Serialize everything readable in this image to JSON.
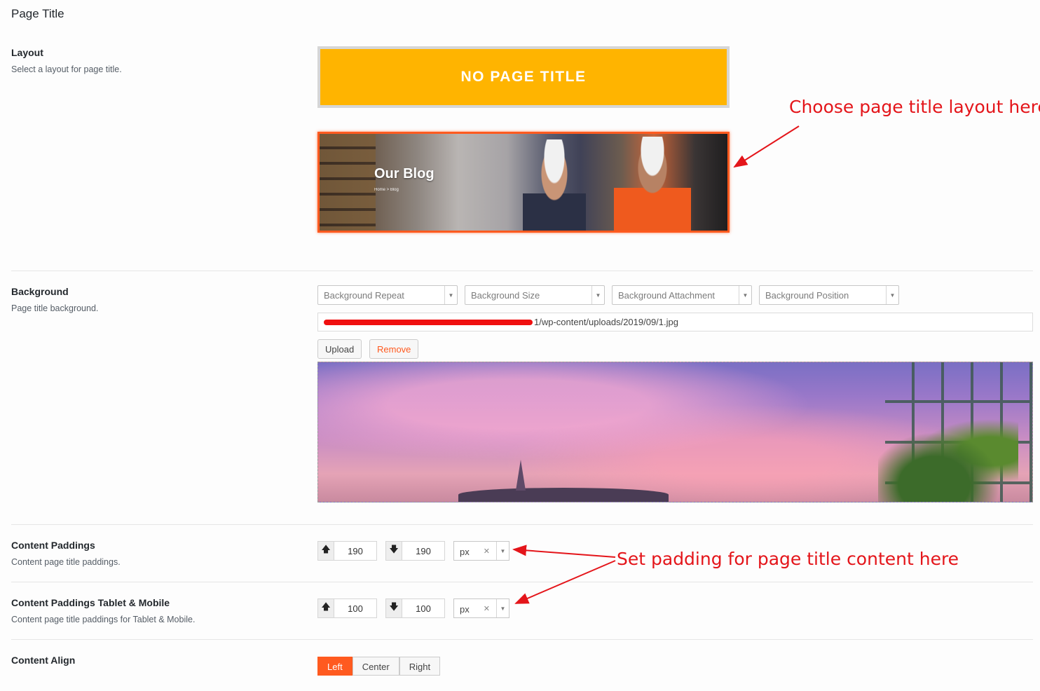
{
  "section_title": "Page Title",
  "layout": {
    "label": "Layout",
    "description": "Select a layout for page title.",
    "option_none_label": "NO PAGE TITLE",
    "option_image": {
      "title": "Our Blog",
      "breadcrumb": "Home  >  Blog"
    },
    "selected": "image"
  },
  "annotations": {
    "layout_note": "Choose page title layout here",
    "padding_note": "Set padding for page title content here"
  },
  "background": {
    "label": "Background",
    "description": "Page title background.",
    "selects": [
      {
        "placeholder": "Background Repeat"
      },
      {
        "placeholder": "Background Size"
      },
      {
        "placeholder": "Background Attachment"
      },
      {
        "placeholder": "Background Position"
      }
    ],
    "url_visible_suffix": "1/wp-content/uploads/2019/09/1.jpg",
    "upload_label": "Upload",
    "remove_label": "Remove"
  },
  "content_paddings": {
    "label": "Content Paddings",
    "description": "Content page title paddings.",
    "top": "190",
    "bottom": "190",
    "unit": "px"
  },
  "content_paddings_mobile": {
    "label": "Content Paddings Tablet & Mobile",
    "description": "Content page title paddings for Tablet & Mobile.",
    "top": "100",
    "bottom": "100",
    "unit": "px"
  },
  "content_align": {
    "label": "Content Align",
    "options": [
      "Left",
      "Center",
      "Right"
    ],
    "selected": "Left"
  },
  "colors": {
    "accent": "#ff5a1f",
    "no_title_bg": "#ffb400",
    "annotation": "#e4151a"
  }
}
